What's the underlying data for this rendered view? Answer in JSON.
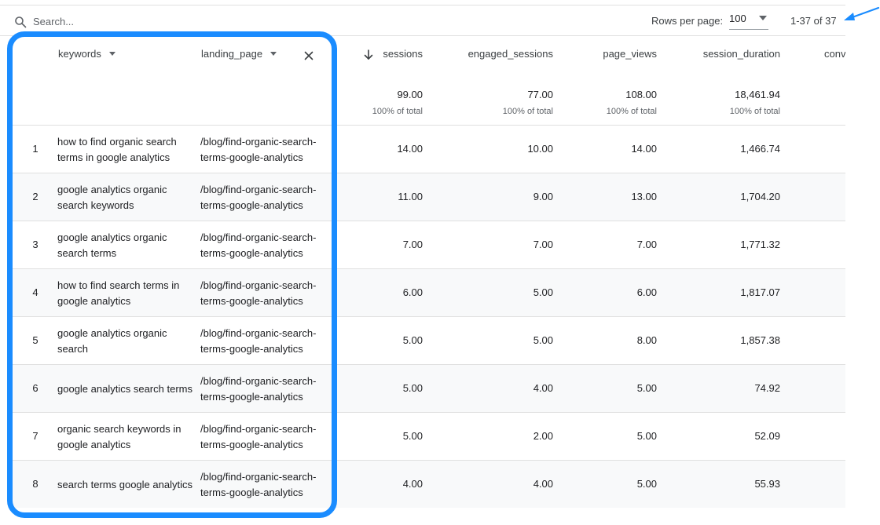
{
  "toolbar": {
    "search_placeholder": "Search...",
    "rows_per_page_label": "Rows per page:",
    "rows_per_page_value": "100",
    "pagination_info": "1-37 of 37"
  },
  "table": {
    "headers": {
      "keywords": "keywords",
      "landing_page": "landing_page",
      "sessions": "sessions",
      "engaged_sessions": "engaged_sessions",
      "page_views": "page_views",
      "session_duration": "session_duration",
      "conversions_partial": "conv"
    },
    "totals": {
      "sessions": "99.00",
      "engaged_sessions": "77.00",
      "page_views": "108.00",
      "session_duration": "18,461.94",
      "sub_label": "100% of total"
    },
    "rows": [
      {
        "index": "1",
        "keywords": "how to find organic search terms in google analytics",
        "landing_page": "/blog/find-organic-search-terms-google-analytics",
        "sessions": "14.00",
        "engaged_sessions": "10.00",
        "page_views": "14.00",
        "session_duration": "1,466.74"
      },
      {
        "index": "2",
        "keywords": "google analytics organic search keywords",
        "landing_page": "/blog/find-organic-search-terms-google-analytics",
        "sessions": "11.00",
        "engaged_sessions": "9.00",
        "page_views": "13.00",
        "session_duration": "1,704.20"
      },
      {
        "index": "3",
        "keywords": "google analytics organic search terms",
        "landing_page": "/blog/find-organic-search-terms-google-analytics",
        "sessions": "7.00",
        "engaged_sessions": "7.00",
        "page_views": "7.00",
        "session_duration": "1,771.32"
      },
      {
        "index": "4",
        "keywords": "how to find search terms in google analytics",
        "landing_page": "/blog/find-organic-search-terms-google-analytics",
        "sessions": "6.00",
        "engaged_sessions": "5.00",
        "page_views": "6.00",
        "session_duration": "1,817.07"
      },
      {
        "index": "5",
        "keywords": "google analytics organic search",
        "landing_page": "/blog/find-organic-search-terms-google-analytics",
        "sessions": "5.00",
        "engaged_sessions": "5.00",
        "page_views": "8.00",
        "session_duration": "1,857.38"
      },
      {
        "index": "6",
        "keywords": "google analytics search terms",
        "landing_page": "/blog/find-organic-search-terms-google-analytics",
        "sessions": "5.00",
        "engaged_sessions": "4.00",
        "page_views": "5.00",
        "session_duration": "74.92"
      },
      {
        "index": "7",
        "keywords": "organic search keywords in google analytics",
        "landing_page": "/blog/find-organic-search-terms-google-analytics",
        "sessions": "5.00",
        "engaged_sessions": "2.00",
        "page_views": "5.00",
        "session_duration": "52.09"
      },
      {
        "index": "8",
        "keywords": "search terms google analytics",
        "landing_page": "/blog/find-organic-search-terms-google-analytics",
        "sessions": "4.00",
        "engaged_sessions": "4.00",
        "page_views": "5.00",
        "session_duration": "55.93"
      }
    ]
  },
  "colors": {
    "annotation_blue": "#1a8cff",
    "alt_row": "#f8f9fa",
    "border": "#e0e0e0"
  },
  "icons": {
    "search": "search-icon",
    "dropdown": "chevron-down-icon",
    "close": "close-icon",
    "sort": "arrow-down-icon",
    "annotation": "arrow-annotation-icon"
  }
}
